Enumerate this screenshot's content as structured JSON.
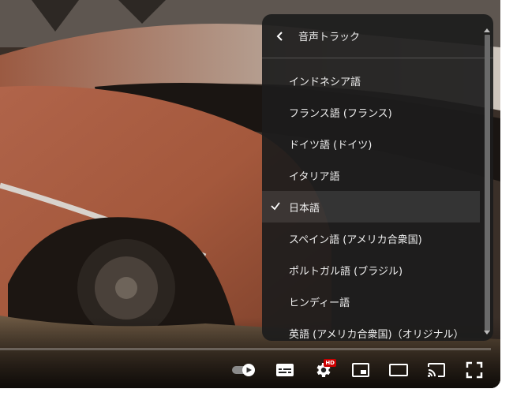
{
  "player": {
    "progress_fraction": 0.0
  },
  "menu": {
    "title": "音声トラック",
    "selected_index": 4,
    "items": [
      {
        "label": "インドネシア語"
      },
      {
        "label": "フランス語 (フランス)"
      },
      {
        "label": "ドイツ語 (ドイツ)"
      },
      {
        "label": "イタリア語"
      },
      {
        "label": "日本語"
      },
      {
        "label": "スペイン語 (アメリカ合衆国)"
      },
      {
        "label": "ポルトガル語 (ブラジル)"
      },
      {
        "label": "ヒンディー語"
      },
      {
        "label": "英語 (アメリカ合衆国)（オリジナル）"
      }
    ]
  },
  "controls": {
    "hd_badge": "HD",
    "icons": [
      "autoplay-toggle-icon",
      "subtitles-icon",
      "settings-gear-icon",
      "miniplayer-icon",
      "theater-mode-icon",
      "cast-icon",
      "fullscreen-icon"
    ]
  },
  "colors": {
    "accent": "#ff0000",
    "menu_bg": "#1c1c1c",
    "hd_badge": "#cc0000"
  }
}
